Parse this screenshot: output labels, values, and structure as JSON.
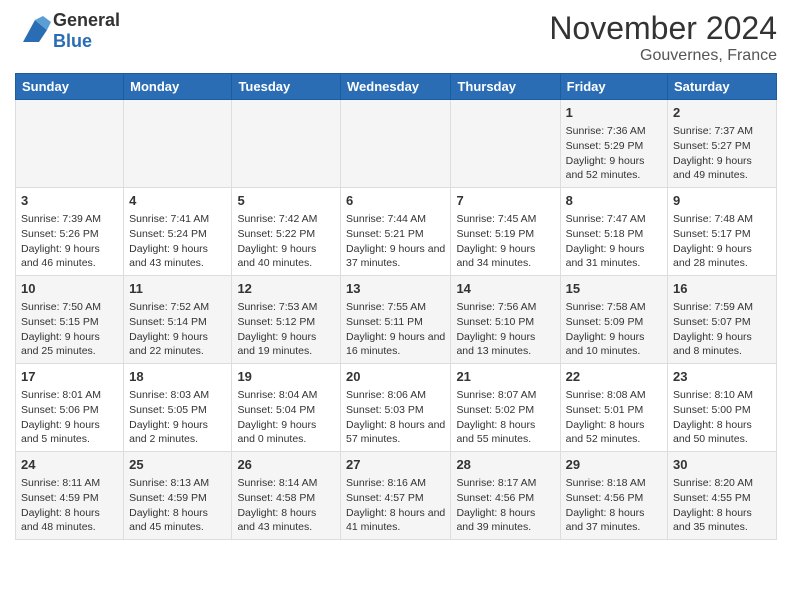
{
  "header": {
    "logo_general": "General",
    "logo_blue": "Blue",
    "month_title": "November 2024",
    "location": "Gouvernes, France"
  },
  "columns": [
    "Sunday",
    "Monday",
    "Tuesday",
    "Wednesday",
    "Thursday",
    "Friday",
    "Saturday"
  ],
  "weeks": [
    [
      {
        "day": "",
        "info": ""
      },
      {
        "day": "",
        "info": ""
      },
      {
        "day": "",
        "info": ""
      },
      {
        "day": "",
        "info": ""
      },
      {
        "day": "",
        "info": ""
      },
      {
        "day": "1",
        "info": "Sunrise: 7:36 AM\nSunset: 5:29 PM\nDaylight: 9 hours and 52 minutes."
      },
      {
        "day": "2",
        "info": "Sunrise: 7:37 AM\nSunset: 5:27 PM\nDaylight: 9 hours and 49 minutes."
      }
    ],
    [
      {
        "day": "3",
        "info": "Sunrise: 7:39 AM\nSunset: 5:26 PM\nDaylight: 9 hours and 46 minutes."
      },
      {
        "day": "4",
        "info": "Sunrise: 7:41 AM\nSunset: 5:24 PM\nDaylight: 9 hours and 43 minutes."
      },
      {
        "day": "5",
        "info": "Sunrise: 7:42 AM\nSunset: 5:22 PM\nDaylight: 9 hours and 40 minutes."
      },
      {
        "day": "6",
        "info": "Sunrise: 7:44 AM\nSunset: 5:21 PM\nDaylight: 9 hours and 37 minutes."
      },
      {
        "day": "7",
        "info": "Sunrise: 7:45 AM\nSunset: 5:19 PM\nDaylight: 9 hours and 34 minutes."
      },
      {
        "day": "8",
        "info": "Sunrise: 7:47 AM\nSunset: 5:18 PM\nDaylight: 9 hours and 31 minutes."
      },
      {
        "day": "9",
        "info": "Sunrise: 7:48 AM\nSunset: 5:17 PM\nDaylight: 9 hours and 28 minutes."
      }
    ],
    [
      {
        "day": "10",
        "info": "Sunrise: 7:50 AM\nSunset: 5:15 PM\nDaylight: 9 hours and 25 minutes."
      },
      {
        "day": "11",
        "info": "Sunrise: 7:52 AM\nSunset: 5:14 PM\nDaylight: 9 hours and 22 minutes."
      },
      {
        "day": "12",
        "info": "Sunrise: 7:53 AM\nSunset: 5:12 PM\nDaylight: 9 hours and 19 minutes."
      },
      {
        "day": "13",
        "info": "Sunrise: 7:55 AM\nSunset: 5:11 PM\nDaylight: 9 hours and 16 minutes."
      },
      {
        "day": "14",
        "info": "Sunrise: 7:56 AM\nSunset: 5:10 PM\nDaylight: 9 hours and 13 minutes."
      },
      {
        "day": "15",
        "info": "Sunrise: 7:58 AM\nSunset: 5:09 PM\nDaylight: 9 hours and 10 minutes."
      },
      {
        "day": "16",
        "info": "Sunrise: 7:59 AM\nSunset: 5:07 PM\nDaylight: 9 hours and 8 minutes."
      }
    ],
    [
      {
        "day": "17",
        "info": "Sunrise: 8:01 AM\nSunset: 5:06 PM\nDaylight: 9 hours and 5 minutes."
      },
      {
        "day": "18",
        "info": "Sunrise: 8:03 AM\nSunset: 5:05 PM\nDaylight: 9 hours and 2 minutes."
      },
      {
        "day": "19",
        "info": "Sunrise: 8:04 AM\nSunset: 5:04 PM\nDaylight: 9 hours and 0 minutes."
      },
      {
        "day": "20",
        "info": "Sunrise: 8:06 AM\nSunset: 5:03 PM\nDaylight: 8 hours and 57 minutes."
      },
      {
        "day": "21",
        "info": "Sunrise: 8:07 AM\nSunset: 5:02 PM\nDaylight: 8 hours and 55 minutes."
      },
      {
        "day": "22",
        "info": "Sunrise: 8:08 AM\nSunset: 5:01 PM\nDaylight: 8 hours and 52 minutes."
      },
      {
        "day": "23",
        "info": "Sunrise: 8:10 AM\nSunset: 5:00 PM\nDaylight: 8 hours and 50 minutes."
      }
    ],
    [
      {
        "day": "24",
        "info": "Sunrise: 8:11 AM\nSunset: 4:59 PM\nDaylight: 8 hours and 48 minutes."
      },
      {
        "day": "25",
        "info": "Sunrise: 8:13 AM\nSunset: 4:59 PM\nDaylight: 8 hours and 45 minutes."
      },
      {
        "day": "26",
        "info": "Sunrise: 8:14 AM\nSunset: 4:58 PM\nDaylight: 8 hours and 43 minutes."
      },
      {
        "day": "27",
        "info": "Sunrise: 8:16 AM\nSunset: 4:57 PM\nDaylight: 8 hours and 41 minutes."
      },
      {
        "day": "28",
        "info": "Sunrise: 8:17 AM\nSunset: 4:56 PM\nDaylight: 8 hours and 39 minutes."
      },
      {
        "day": "29",
        "info": "Sunrise: 8:18 AM\nSunset: 4:56 PM\nDaylight: 8 hours and 37 minutes."
      },
      {
        "day": "30",
        "info": "Sunrise: 8:20 AM\nSunset: 4:55 PM\nDaylight: 8 hours and 35 minutes."
      }
    ]
  ]
}
